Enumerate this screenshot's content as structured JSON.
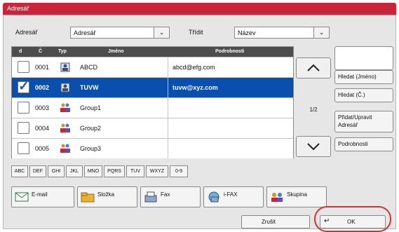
{
  "window": {
    "title": "Adresář"
  },
  "filter": {
    "addressbook_label": "Adresář",
    "addressbook_value": "Adresář",
    "sort_label": "Třídit",
    "sort_value": "Název"
  },
  "table": {
    "headers": {
      "count": "d",
      "number": "Č",
      "type": "Typ",
      "name": "Jméno",
      "details": "Podrobnosti"
    },
    "rows": [
      {
        "number": "0001",
        "name": "ABCD",
        "details": "abcd@efg.com",
        "type": "person",
        "checked": false,
        "selected": false
      },
      {
        "number": "0002",
        "name": "TUVW",
        "details": "tuvw@xyz.com",
        "type": "person",
        "checked": true,
        "selected": true
      },
      {
        "number": "0003",
        "name": "Group1",
        "details": "",
        "type": "group",
        "checked": false,
        "selected": false
      },
      {
        "number": "0004",
        "name": "Group2",
        "details": "",
        "type": "group",
        "checked": false,
        "selected": false
      },
      {
        "number": "0005",
        "name": "Group3",
        "details": "",
        "type": "group",
        "checked": false,
        "selected": false
      }
    ]
  },
  "pager": {
    "page": "1/2"
  },
  "side_buttons": {
    "search_name": "Hledat (Jméno)",
    "search_number": "Hledat (Č.)",
    "add_edit": "Přidat/Upravit Adresář",
    "details": "Podrobnosti"
  },
  "alpha_tabs": [
    "ABC",
    "DEF",
    "GHI",
    "JKL",
    "MNO",
    "PQRS",
    "TUV",
    "WXYZ",
    "0-9"
  ],
  "destinations": {
    "email": "E-mail",
    "folder": "Složka",
    "fax": "Fax",
    "ifax": "i-FAX",
    "group": "Skupina"
  },
  "footer": {
    "cancel": "Zrušit",
    "ok": "OK"
  },
  "colors": {
    "title_bar": "#c8253b",
    "selected_row": "#0b4fae",
    "highlight_ring": "#d9302f"
  }
}
